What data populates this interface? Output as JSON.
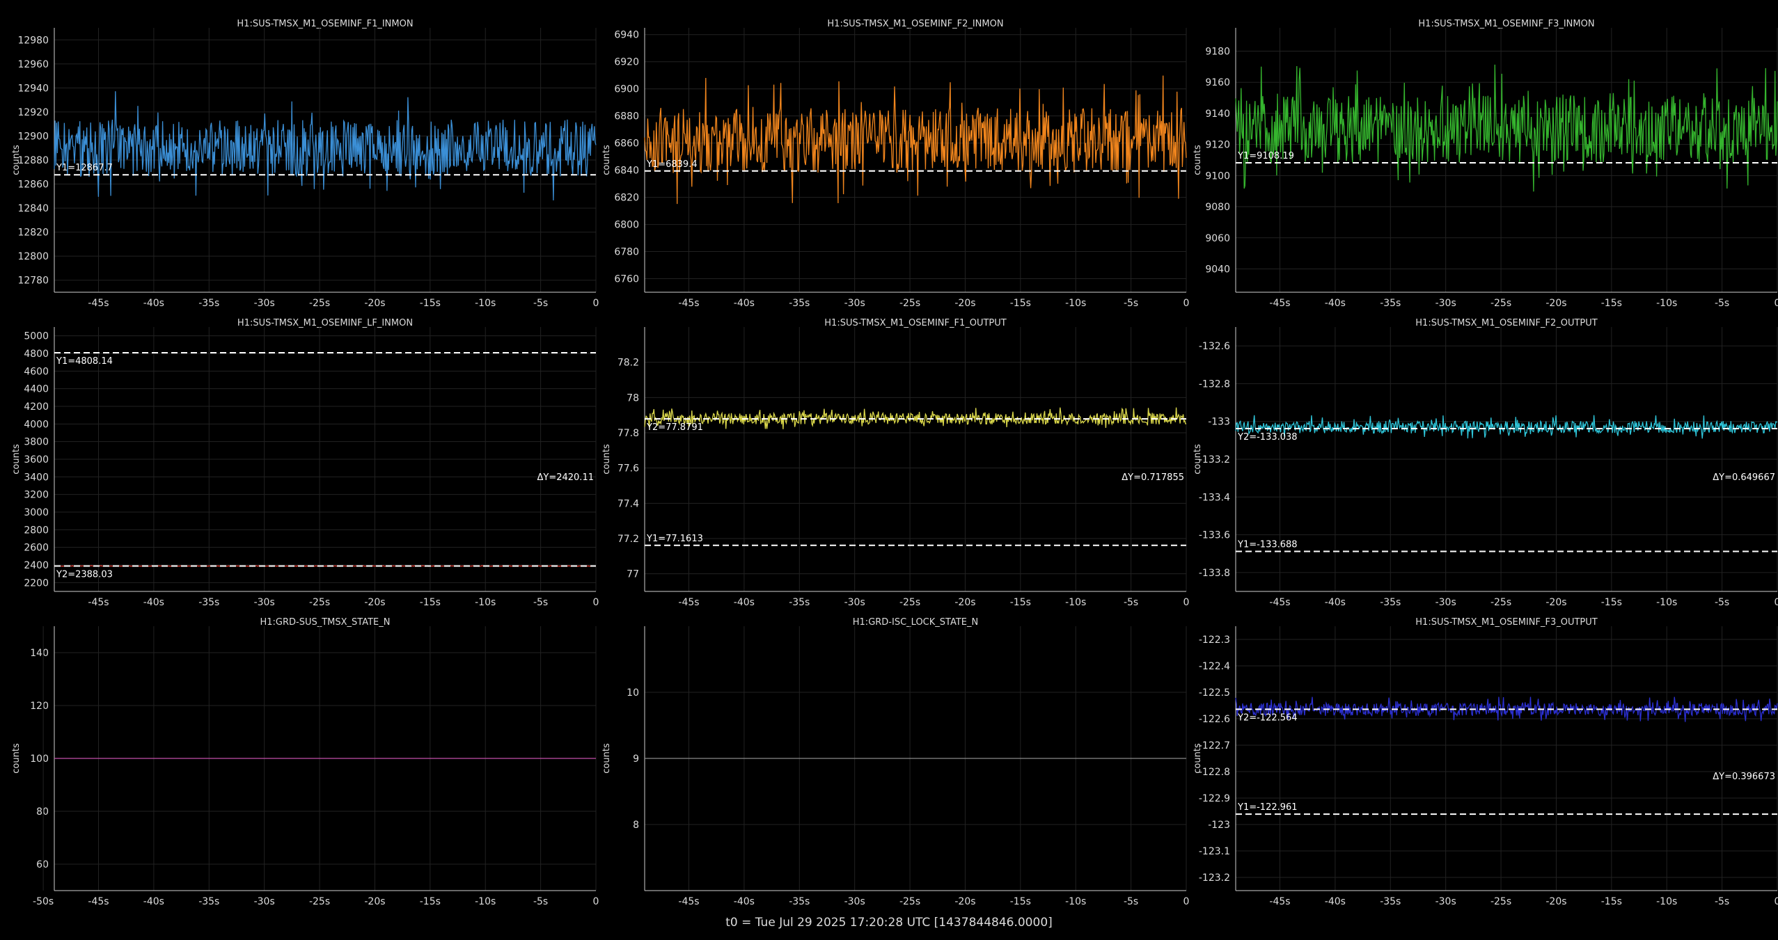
{
  "footer": "t0 = Tue Jul 29 2025 17:20:28 UTC [1437844846.0000]",
  "x_ticks": [
    "-45s",
    "-40s",
    "-35s",
    "-30s",
    "-25s",
    "-20s",
    "-15s",
    "-10s",
    "-5s",
    "0"
  ],
  "x_ticks_state": [
    "-50s",
    "-45s",
    "-40s",
    "-35s",
    "-30s",
    "-25s",
    "-20s",
    "-15s",
    "-10s",
    "-5s",
    "0"
  ],
  "chart_data": [
    {
      "type": "line",
      "title": "H1:SUS-TMSX_M1_OSEMINF_F1_INMON",
      "ylabel": "counts",
      "color": "#3b8fd6",
      "ylim": [
        12770,
        12990
      ],
      "yticks": [
        12780,
        12800,
        12820,
        12840,
        12860,
        12880,
        12900,
        12920,
        12940,
        12960,
        12980
      ],
      "center": 12890,
      "amp": 30,
      "cursors": [
        {
          "label": "Y1=12867.7",
          "value": 12867.7
        }
      ],
      "delta": ""
    },
    {
      "type": "line",
      "title": "H1:SUS-TMSX_M1_OSEMINF_F2_INMON",
      "ylabel": "counts",
      "color": "#f0851d",
      "ylim": [
        6750,
        6945
      ],
      "yticks": [
        6760,
        6780,
        6800,
        6820,
        6840,
        6860,
        6880,
        6900,
        6920,
        6940
      ],
      "center": 6862,
      "amp": 30,
      "cursors": [
        {
          "label": "Y1=6839.4",
          "value": 6839.4
        }
      ],
      "delta": ""
    },
    {
      "type": "line",
      "title": "H1:SUS-TMSX_M1_OSEMINF_F3_INMON",
      "ylabel": "counts",
      "color": "#35b52e",
      "ylim": [
        9025,
        9195
      ],
      "yticks": [
        9040,
        9060,
        9080,
        9100,
        9120,
        9140,
        9160,
        9180
      ],
      "center": 9130,
      "amp": 27,
      "cursors": [
        {
          "label": "Y1=9108.19",
          "value": 9108.19
        }
      ],
      "delta": ""
    },
    {
      "type": "line",
      "title": "H1:SUS-TMSX_M1_OSEMINF_LF_INMON",
      "ylabel": "counts",
      "color": "#e03a2f",
      "ylim": [
        2100,
        5100
      ],
      "yticks": [
        2200,
        2400,
        2600,
        2800,
        3000,
        3200,
        3400,
        3600,
        3800,
        4000,
        4200,
        4400,
        4600,
        4800,
        5000
      ],
      "center": 2388,
      "amp": 3,
      "cursors": [
        {
          "label": "Y1=4808.14",
          "value": 4808.14
        },
        {
          "label": "Y2=2388.03",
          "value": 2388.03
        }
      ],
      "delta": "ΔY=2420.11"
    },
    {
      "type": "line",
      "title": "H1:SUS-TMSX_M1_OSEMINF_F1_OUTPUT",
      "ylabel": "counts",
      "color": "#d9d64a",
      "ylim": [
        76.9,
        78.4
      ],
      "yticks": [
        77,
        77.2,
        77.4,
        77.6,
        77.8,
        78,
        78.2
      ],
      "center": 77.88,
      "amp": 0.04,
      "cursors": [
        {
          "label": "Y2=77.8791",
          "value": 77.8791
        },
        {
          "label": "Y1=77.1613",
          "value": 77.1613
        }
      ],
      "delta": "ΔY=0.717855"
    },
    {
      "type": "line",
      "title": "H1:SUS-TMSX_M1_OSEMINF_F2_OUTPUT",
      "ylabel": "counts",
      "color": "#2ec4d8",
      "ylim": [
        -133.9,
        -132.5
      ],
      "yticks": [
        -133.8,
        -133.6,
        -133.4,
        -133.2,
        -133,
        -132.8,
        -132.6
      ],
      "center": -133.03,
      "amp": 0.04,
      "cursors": [
        {
          "label": "Y2=-133.038",
          "value": -133.038
        },
        {
          "label": "Y1=-133.688",
          "value": -133.688
        }
      ],
      "delta": "ΔY=0.649667"
    },
    {
      "type": "line",
      "title": "H1:GRD-SUS_TMSX_STATE_N",
      "ylabel": "counts",
      "color": "#c34fa9",
      "ylim": [
        50,
        150
      ],
      "yticks": [
        60,
        80,
        100,
        120,
        140
      ],
      "center": 100,
      "amp": 0,
      "cursors": [],
      "delta": "",
      "xticks": "state"
    },
    {
      "type": "line",
      "title": "H1:GRD-ISC_LOCK_STATE_N",
      "ylabel": "counts",
      "color": "#8a8a8a",
      "ylim": [
        7,
        11
      ],
      "yticks": [
        8,
        9,
        10
      ],
      "center": 9,
      "amp": 0,
      "cursors": [],
      "delta": ""
    },
    {
      "type": "line",
      "title": "H1:SUS-TMSX_M1_OSEMINF_F3_OUTPUT",
      "ylabel": "counts",
      "color": "#2b2fd0",
      "ylim": [
        -123.25,
        -122.25
      ],
      "yticks": [
        -123.2,
        -123.1,
        -123,
        -122.9,
        -122.8,
        -122.7,
        -122.6,
        -122.5,
        -122.4,
        -122.3
      ],
      "center": -122.565,
      "amp": 0.03,
      "cursors": [
        {
          "label": "Y2=-122.564",
          "value": -122.564
        },
        {
          "label": "Y1=-122.961",
          "value": -122.961
        }
      ],
      "delta": "ΔY=0.396673"
    }
  ]
}
